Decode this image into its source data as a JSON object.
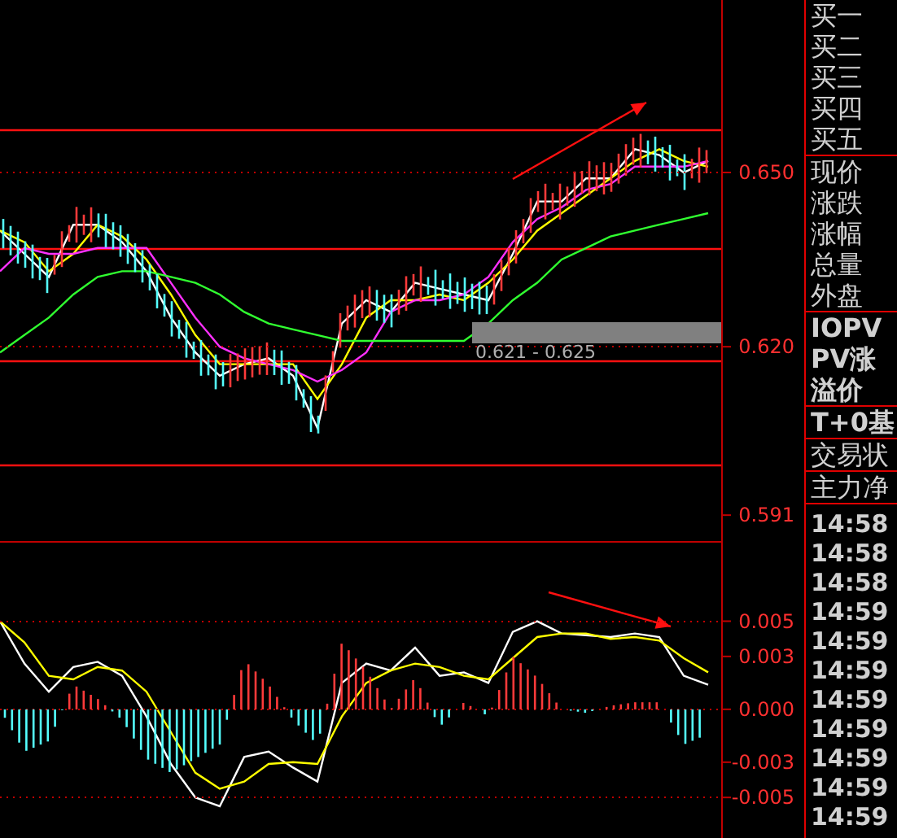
{
  "price_chart": {
    "chart_data": {
      "type": "line",
      "ylim": [
        0.5864,
        0.6797
      ],
      "yticks": [
        {
          "value": 0.65,
          "label": "0.650"
        },
        {
          "value": 0.62,
          "label": "0.620"
        },
        {
          "value": 0.591,
          "label": "0.591"
        }
      ],
      "series": [
        {
          "color": "#ffffff",
          "values": [
            0.64,
            0.636,
            0.632,
            0.641,
            0.641,
            0.638,
            0.633,
            0.625,
            0.619,
            0.615,
            0.617,
            0.618,
            0.615,
            0.606,
            0.624,
            0.628,
            0.626,
            0.631,
            0.63,
            0.629,
            0.628,
            0.636,
            0.645,
            0.645,
            0.649,
            0.649,
            0.654,
            0.653,
            0.65,
            0.652
          ]
        },
        {
          "color": "#ffff00",
          "values": [
            0.64,
            0.638,
            0.633,
            0.636,
            0.641,
            0.639,
            0.635,
            0.629,
            0.622,
            0.617,
            0.617,
            0.617,
            0.617,
            0.611,
            0.617,
            0.625,
            0.628,
            0.628,
            0.629,
            0.628,
            0.631,
            0.635,
            0.64,
            0.643,
            0.646,
            0.649,
            0.652,
            0.654,
            0.652,
            0.651
          ]
        },
        {
          "color": "#ff30ff",
          "values": [
            0.633,
            0.637,
            0.636,
            0.636,
            0.637,
            0.637,
            0.637,
            0.631,
            0.625,
            0.62,
            0.618,
            0.617,
            0.616,
            0.614,
            0.616,
            0.619,
            0.626,
            0.628,
            0.628,
            0.629,
            0.632,
            0.638,
            0.642,
            0.644,
            0.647,
            0.648,
            0.651,
            0.651,
            0.651,
            0.652
          ]
        },
        {
          "color": "#30ff30",
          "values": [
            0.619,
            0.622,
            0.625,
            0.629,
            0.632,
            0.633,
            0.633,
            0.632,
            0.631,
            0.629,
            0.626,
            0.624,
            0.623,
            0.622,
            0.621,
            0.621,
            0.621,
            0.621,
            0.621,
            0.621,
            0.624,
            0.628,
            0.631,
            0.635,
            0.637,
            0.639,
            0.64,
            0.641,
            0.642,
            0.643
          ]
        }
      ]
    },
    "range_label": "0.621 - 0.625"
  },
  "macd_chart": {
    "chart_data": {
      "type": "line",
      "ylim": [
        -0.0073,
        0.0095
      ],
      "yticks": [
        {
          "value": 0.005,
          "label": "0.005"
        },
        {
          "value": 0.003,
          "label": "0.003"
        },
        {
          "value": 0,
          "label": "0.000"
        },
        {
          "value": -0.003,
          "label": "-0.003"
        },
        {
          "value": -0.005,
          "label": "-0.005"
        }
      ],
      "series": [
        {
          "color": "#ffffff",
          "values": [
            0.005,
            0.0026,
            0.001,
            0.0024,
            0.0027,
            0.0019,
            -0.0004,
            -0.0031,
            -0.005,
            -0.0055,
            -0.0027,
            -0.0024,
            -0.0033,
            -0.0041,
            0.0015,
            0.0026,
            0.0022,
            0.0035,
            0.0019,
            0.0021,
            0.0015,
            0.0044,
            0.005,
            0.0043,
            0.0042,
            0.0041,
            0.0043,
            0.0041,
            0.0019,
            0.0014
          ]
        },
        {
          "color": "#ffff00",
          "values": [
            0.005,
            0.0038,
            0.0019,
            0.0017,
            0.0024,
            0.0022,
            0.001,
            -0.0013,
            -0.0036,
            -0.0045,
            -0.0041,
            -0.0031,
            -0.003,
            -0.0031,
            -0.0004,
            0.0015,
            0.0022,
            0.0026,
            0.0024,
            0.0019,
            0.0017,
            0.0029,
            0.0041,
            0.0043,
            0.0043,
            0.004,
            0.0041,
            0.0039,
            0.0029,
            0.0021
          ]
        }
      ]
    }
  },
  "quote_panel": [
    {
      "kind": "list",
      "rows": [
        "买一",
        "买二",
        "买三",
        "买四",
        "买五"
      ]
    },
    {
      "kind": "list",
      "rows": [
        "现价",
        "涨跌",
        "涨幅",
        "总量",
        "外盘"
      ]
    },
    {
      "kind": "etf",
      "rows": [
        "IOPV",
        "PV涨",
        "溢价"
      ]
    },
    {
      "kind": "etf",
      "rows": [
        "T+0基"
      ]
    },
    {
      "kind": "list",
      "rows": [
        "交易状"
      ]
    },
    {
      "kind": "list",
      "rows": [
        "主力净"
      ]
    }
  ],
  "trade_times": [
    "14:58",
    "14:58",
    "14:58",
    "14:59",
    "14:59",
    "14:59",
    "14:59",
    "14:59",
    "14:59",
    "14:59",
    "14:59"
  ]
}
